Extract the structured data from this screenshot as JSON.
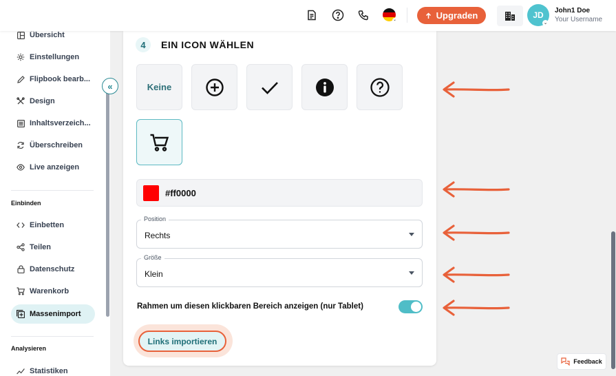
{
  "header": {
    "upgrade_label": "Upgraden",
    "avatar_initials": "JD",
    "user_name": "John1 Doe",
    "user_subtitle": "Your Username"
  },
  "sidebar": {
    "items": [
      {
        "label": "Übersicht"
      },
      {
        "label": "Einstellungen"
      },
      {
        "label": "Flipbook bearb..."
      },
      {
        "label": "Design"
      },
      {
        "label": "Inhaltsverzeich..."
      },
      {
        "label": "Überschreiben"
      },
      {
        "label": "Live anzeigen"
      }
    ],
    "section_embed": "Einbinden",
    "embed_items": [
      {
        "label": "Einbetten"
      },
      {
        "label": "Teilen"
      },
      {
        "label": "Datenschutz"
      },
      {
        "label": "Warenkorb"
      },
      {
        "label": "Massenimport"
      }
    ],
    "section_analyze": "Analysieren",
    "analyze_items": [
      {
        "label": "Statistiken"
      }
    ]
  },
  "card": {
    "step_number": "4",
    "step_title": "EIN ICON WÄHLEN",
    "icon_options": [
      {
        "label": "Keine",
        "icon": "none"
      },
      {
        "icon": "plus-circle-icon"
      },
      {
        "icon": "check-icon"
      },
      {
        "icon": "info-icon"
      },
      {
        "icon": "help-circle-icon"
      },
      {
        "icon": "cart-icon",
        "selected": true
      }
    ],
    "color_value": "#ff0000",
    "position": {
      "label": "Position",
      "value": "Rechts"
    },
    "size": {
      "label": "Größe",
      "value": "Klein"
    },
    "toggle_label": "Rahmen um diesen klickbaren Bereich anzeigen (nur Tablet)",
    "toggle_on": true,
    "import_button": "Links importieren"
  },
  "feedback_label": "Feedback",
  "colors": {
    "accent": "#e8613a",
    "teal": "#4fbdc7",
    "swatch": "#ff0000"
  }
}
